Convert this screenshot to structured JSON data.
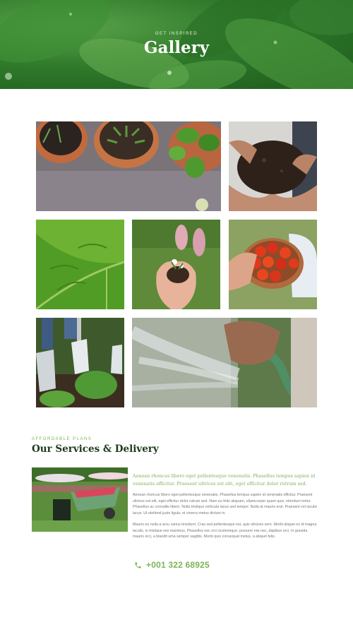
{
  "hero": {
    "eyebrow": "GET INSPIRED",
    "title": "Gallery"
  },
  "gallery": {
    "images": [
      {
        "name": "potted-seedlings-photo"
      },
      {
        "name": "hands-holding-soil-photo"
      },
      {
        "name": "green-leaf-closeup-photo"
      },
      {
        "name": "hands-holding-flower-photo"
      },
      {
        "name": "tomato-bowl-photo"
      },
      {
        "name": "shovel-digging-photo"
      },
      {
        "name": "garden-hose-watering-photo"
      }
    ]
  },
  "services": {
    "eyebrow": "AFFORDABLE PLANS",
    "title": "Our Services & Delivery",
    "lead": "Aenean rhoncus libero eget pellentesque venenatis. Phasellus tempus sapien id venenatis efficitur. Praesent ultrices est elit, eget efficitur dolor rutrum sed.",
    "paragraph1": "Aenean rhoncus libero eget pellentesque venenatis. Phasellus tempus sapien id venenatis efficitur. Praesent ultrices est elit, eget efficitur dolor rutrum sed. Nam eu felis aliquam, ullamcorper quam quis, interdum tortor. Phasellus ac convallis libero. Nulla tristique vehicula lacus sed tempor. Nulla at mauris erat. Praesent vel iaculis lacus. Ut eleifend justo ligula, et viverra metus dictum in.",
    "paragraph2": "Mauris eu nulla a arcu varius tincidunt. Cras sed pellentesque est, quis ultricies sem. Morbi aliquet ex id magna iaculis, in tristique nisi maximus. Phasellus nec orci scelerisque, posuere nisi nec, dapibus orci. In gravida mauris orci, a blandit uma semper sagittis. Morbi quis consequat metus, a aliquet felis.",
    "phone": "+001 322 68925",
    "phone_icon": "phone-icon",
    "accent_color": "#7cb356",
    "title_color": "#1e3b1a"
  }
}
